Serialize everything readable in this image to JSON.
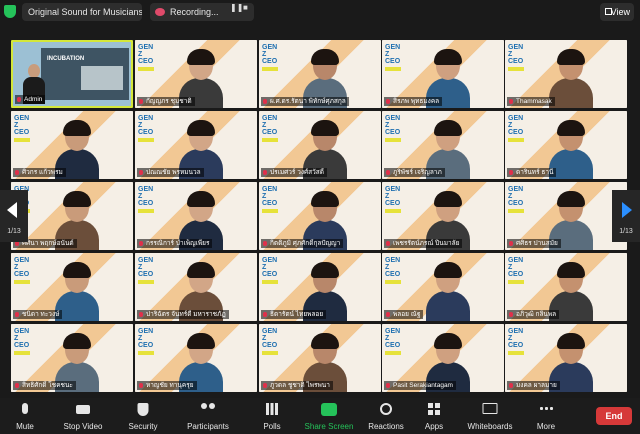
{
  "topbar": {
    "sound_label": "Original Sound for Musicians: On",
    "recording_label": "Recording...",
    "pause_icon": "pause-icon",
    "stop_icon": "stop-icon",
    "view_label": "View"
  },
  "gallery": {
    "page_left": "1/13",
    "page_right": "1/13",
    "tile_logo": {
      "line1": "GEN",
      "line2": "Z",
      "line3": "CEO"
    },
    "participants": [
      {
        "name": "Admin",
        "active": true
      },
      {
        "name": "กัญญภร ชุมชาติ",
        "active": false
      },
      {
        "name": "ผ.ศ.ดร.รัตนา พิทักษ์ศุภสกุล",
        "active": false
      },
      {
        "name": "สิรภพ พุทธมงคล",
        "active": false
      },
      {
        "name": "Thammasak",
        "active": false
      },
      {
        "name": "ศิวกร แก้วพรม",
        "active": false
      },
      {
        "name": "ปณณชัย พรหมนวล",
        "active": false
      },
      {
        "name": "ปรเมศวร์ วงศ์สวัสดิ์",
        "active": false
      },
      {
        "name": "ภูริพัชร์ เจริญลาภ",
        "active": false
      },
      {
        "name": "ดารินทร์ ธานี",
        "active": false
      },
      {
        "name": "ศศินา พฤกษ์อนันต์",
        "active": false
      },
      {
        "name": "กรรณิการ์ บำเพ็ญเพียร",
        "active": false
      },
      {
        "name": "กิตติภูมิ ศุภศักดิ์กุลปัญญา",
        "active": false
      },
      {
        "name": "เพชรรัตน์ภรณ์ ปิ่นมาลัย",
        "active": false
      },
      {
        "name": "ศศิธร ปานสมัย",
        "active": false
      },
      {
        "name": "ชนิดา ทะวงษ์",
        "active": false
      },
      {
        "name": "ปาริฉัตร จันทร์ดี มหาราชภัฏ",
        "active": false
      },
      {
        "name": "ธิดารัตน์ ไทยพลอย",
        "active": false
      },
      {
        "name": "พลอย ณัฐ",
        "active": false
      },
      {
        "name": "อภิวุฒิ กลิ่นพล",
        "active": false
      },
      {
        "name": "สิทธิศักดิ์ โชคชนะ",
        "active": false
      },
      {
        "name": "หาญชัย ทานุครุย",
        "active": false
      },
      {
        "name": "ภูวดล ชูชาติ ไพรพนา",
        "active": false
      },
      {
        "name": "Pasit Serakiantagam",
        "active": false
      },
      {
        "name": "มงคล ผาลมาย",
        "active": false
      }
    ]
  },
  "toolbar": {
    "mute": "Mute",
    "stop_video": "Stop Video",
    "security": "Security",
    "participants": "Participants",
    "participants_count": "",
    "polls": "Polls",
    "share_screen": "Share Screen",
    "reactions": "Reactions",
    "apps": "Apps",
    "whiteboards": "Whiteboards",
    "more": "More",
    "end": "End"
  },
  "admin_tile": {
    "board_text": "INCUBATION"
  },
  "colors": {
    "accent_active": "#d4e73a",
    "end_button": "#d63939",
    "share_green": "#25c25a",
    "logo_blue": "#1e6fb0"
  }
}
